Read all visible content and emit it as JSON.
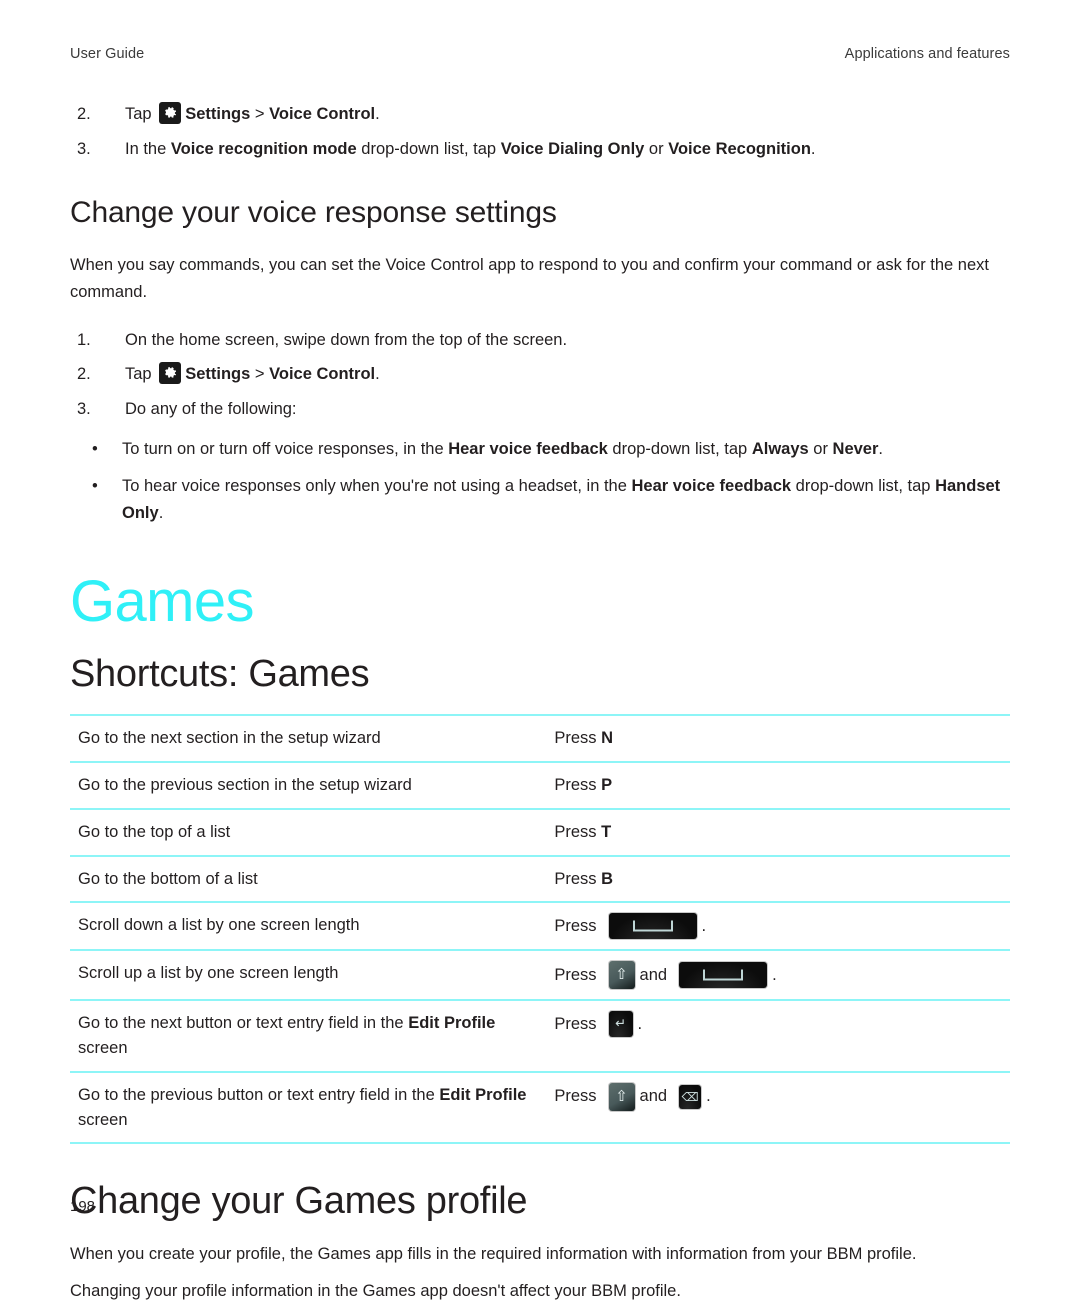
{
  "header": {
    "left": "User Guide",
    "right": "Applications and features"
  },
  "top_steps": [
    {
      "num": "2.",
      "pre": "Tap ",
      "icon": "settings-gear-icon",
      "bold1": "Settings",
      "sep": " > ",
      "bold2": "Voice Control",
      "post": "."
    },
    {
      "num": "3.",
      "text_parts": [
        "In the ",
        "Voice recognition mode",
        " drop-down list, tap ",
        "Voice Dialing Only",
        " or ",
        "Voice Recognition",
        "."
      ]
    }
  ],
  "voice_section": {
    "heading": "Change your voice response settings",
    "intro": "When you say commands, you can set the Voice Control app to respond to you and confirm your command or ask for the next command.",
    "steps": [
      {
        "num": "1.",
        "text": "On the home screen, swipe down from the top of the screen."
      },
      {
        "num": "2.",
        "pre": "Tap ",
        "icon": "settings-gear-icon",
        "bold1": "Settings",
        "sep": " > ",
        "bold2": "Voice Control",
        "post": "."
      },
      {
        "num": "3.",
        "text": "Do any of the following:"
      }
    ],
    "bullets": [
      {
        "marker": "•",
        "parts": [
          "To turn on or turn off voice responses, in the ",
          "Hear voice feedback",
          " drop-down list, tap ",
          "Always",
          " or ",
          "Never",
          "."
        ]
      },
      {
        "marker": "•",
        "parts": [
          "To hear voice responses only when you're not using a headset, in the ",
          "Hear voice feedback",
          " drop-down list, tap ",
          "Handset Only",
          "."
        ]
      }
    ]
  },
  "chapter_title": "Games",
  "shortcuts": {
    "heading": "Shortcuts: Games",
    "press_label": "Press",
    "and_label": "and",
    "period": ".",
    "rows": [
      {
        "desc": "Go to the next section in the setup wizard",
        "action_type": "letter",
        "key": "N"
      },
      {
        "desc": "Go to the previous section in the setup wizard",
        "action_type": "letter",
        "key": "P"
      },
      {
        "desc": "Go to the top of a list",
        "action_type": "letter",
        "key": "T"
      },
      {
        "desc": "Go to the bottom of a list",
        "action_type": "letter",
        "key": "B"
      },
      {
        "desc": "Scroll down a list by one screen length",
        "action_type": "keycap",
        "keys": [
          "space-key"
        ]
      },
      {
        "desc": "Scroll up a list by one screen length",
        "action_type": "keycap",
        "keys": [
          "shift-key",
          "space-key"
        ]
      },
      {
        "desc_parts": [
          "Go to the next button or text entry field in the ",
          "Edit Profile",
          " screen"
        ],
        "action_type": "keycap",
        "keys": [
          "enter-key"
        ]
      },
      {
        "desc_parts": [
          "Go to the previous button or text entry field in the ",
          "Edit Profile",
          " screen"
        ],
        "action_type": "keycap",
        "keys": [
          "shift-key",
          "backspace-key"
        ]
      }
    ]
  },
  "profile_section": {
    "heading": "Change your Games profile",
    "para1": "When you create your profile, the Games app fills in the required information with information from your BBM profile.",
    "para2": "Changing your profile information in the Games app doesn't affect your BBM profile."
  },
  "folio": "198",
  "colors": {
    "chapter_accent": "#2ff0f7",
    "table_rule": "#8df5f7",
    "body_text": "#231f20"
  }
}
